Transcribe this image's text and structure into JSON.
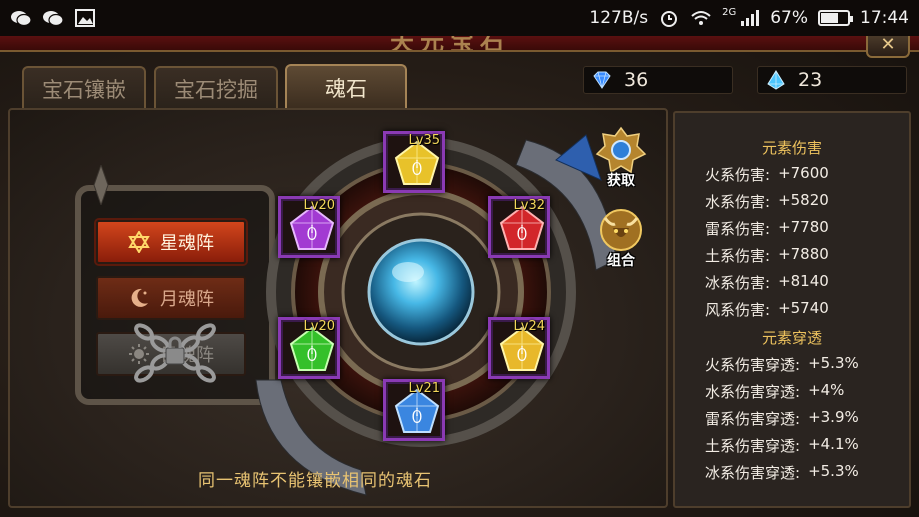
{
  "status_bar": {
    "net_speed": "127B/s",
    "signal": "2G",
    "battery": "67%",
    "time": "17:44",
    "battery_level": 0.67
  },
  "header": {
    "title": "天元宝石",
    "close_label": "✕"
  },
  "tabs": [
    {
      "label": "宝石镶嵌",
      "active": false
    },
    {
      "label": "宝石挖掘",
      "active": false
    },
    {
      "label": "魂石",
      "active": true
    }
  ],
  "currency": {
    "diamonds": "36",
    "crystals": "23",
    "diamond_icon": "diamond-icon",
    "crystal_icon": "crystal-icon"
  },
  "arrays": {
    "star": {
      "label": "星魂阵",
      "icon": "hexagram-icon",
      "state": "selected"
    },
    "moon": {
      "label": "月魂阵",
      "icon": "crescent-icon",
      "state": "available"
    },
    "sun": {
      "label": "日魂阵",
      "icon": "sun-icon",
      "state": "locked"
    }
  },
  "slots": {
    "top": {
      "level": "Lv35",
      "color": "yellow"
    },
    "upper_left": {
      "level": "Lv20",
      "color": "purple"
    },
    "upper_right": {
      "level": "Lv32",
      "color": "red"
    },
    "lower_left": {
      "level": "Lv20",
      "color": "green"
    },
    "lower_right": {
      "level": "Lv24",
      "color": "yellow"
    },
    "bottom": {
      "level": "Lv21",
      "color": "blue"
    }
  },
  "side_actions": {
    "obtain": "获取",
    "combine": "组合"
  },
  "hint": "同一魂阵不能镶嵌相同的魂石",
  "stats": {
    "damage_title": "元素伤害",
    "damage": [
      {
        "label": "火系伤害:",
        "value": "+7600"
      },
      {
        "label": "水系伤害:",
        "value": "+5820"
      },
      {
        "label": "雷系伤害:",
        "value": "+7780"
      },
      {
        "label": "土系伤害:",
        "value": "+7880"
      },
      {
        "label": "冰系伤害:",
        "value": "+8140"
      },
      {
        "label": "风系伤害:",
        "value": "+5740"
      }
    ],
    "pen_title": "元素穿透",
    "penetration": [
      {
        "label": "火系伤害穿透:",
        "value": "+5.3%"
      },
      {
        "label": "水系伤害穿透:",
        "value": "+4%"
      },
      {
        "label": "雷系伤害穿透:",
        "value": "+3.9%"
      },
      {
        "label": "土系伤害穿透:",
        "value": "+4.1%"
      },
      {
        "label": "冰系伤害穿透:",
        "value": "+5.3%"
      }
    ]
  },
  "colors": {
    "accent_gold": "#eec35e",
    "slot_border": "#8a3ab4",
    "active_button": "#d2461c"
  }
}
